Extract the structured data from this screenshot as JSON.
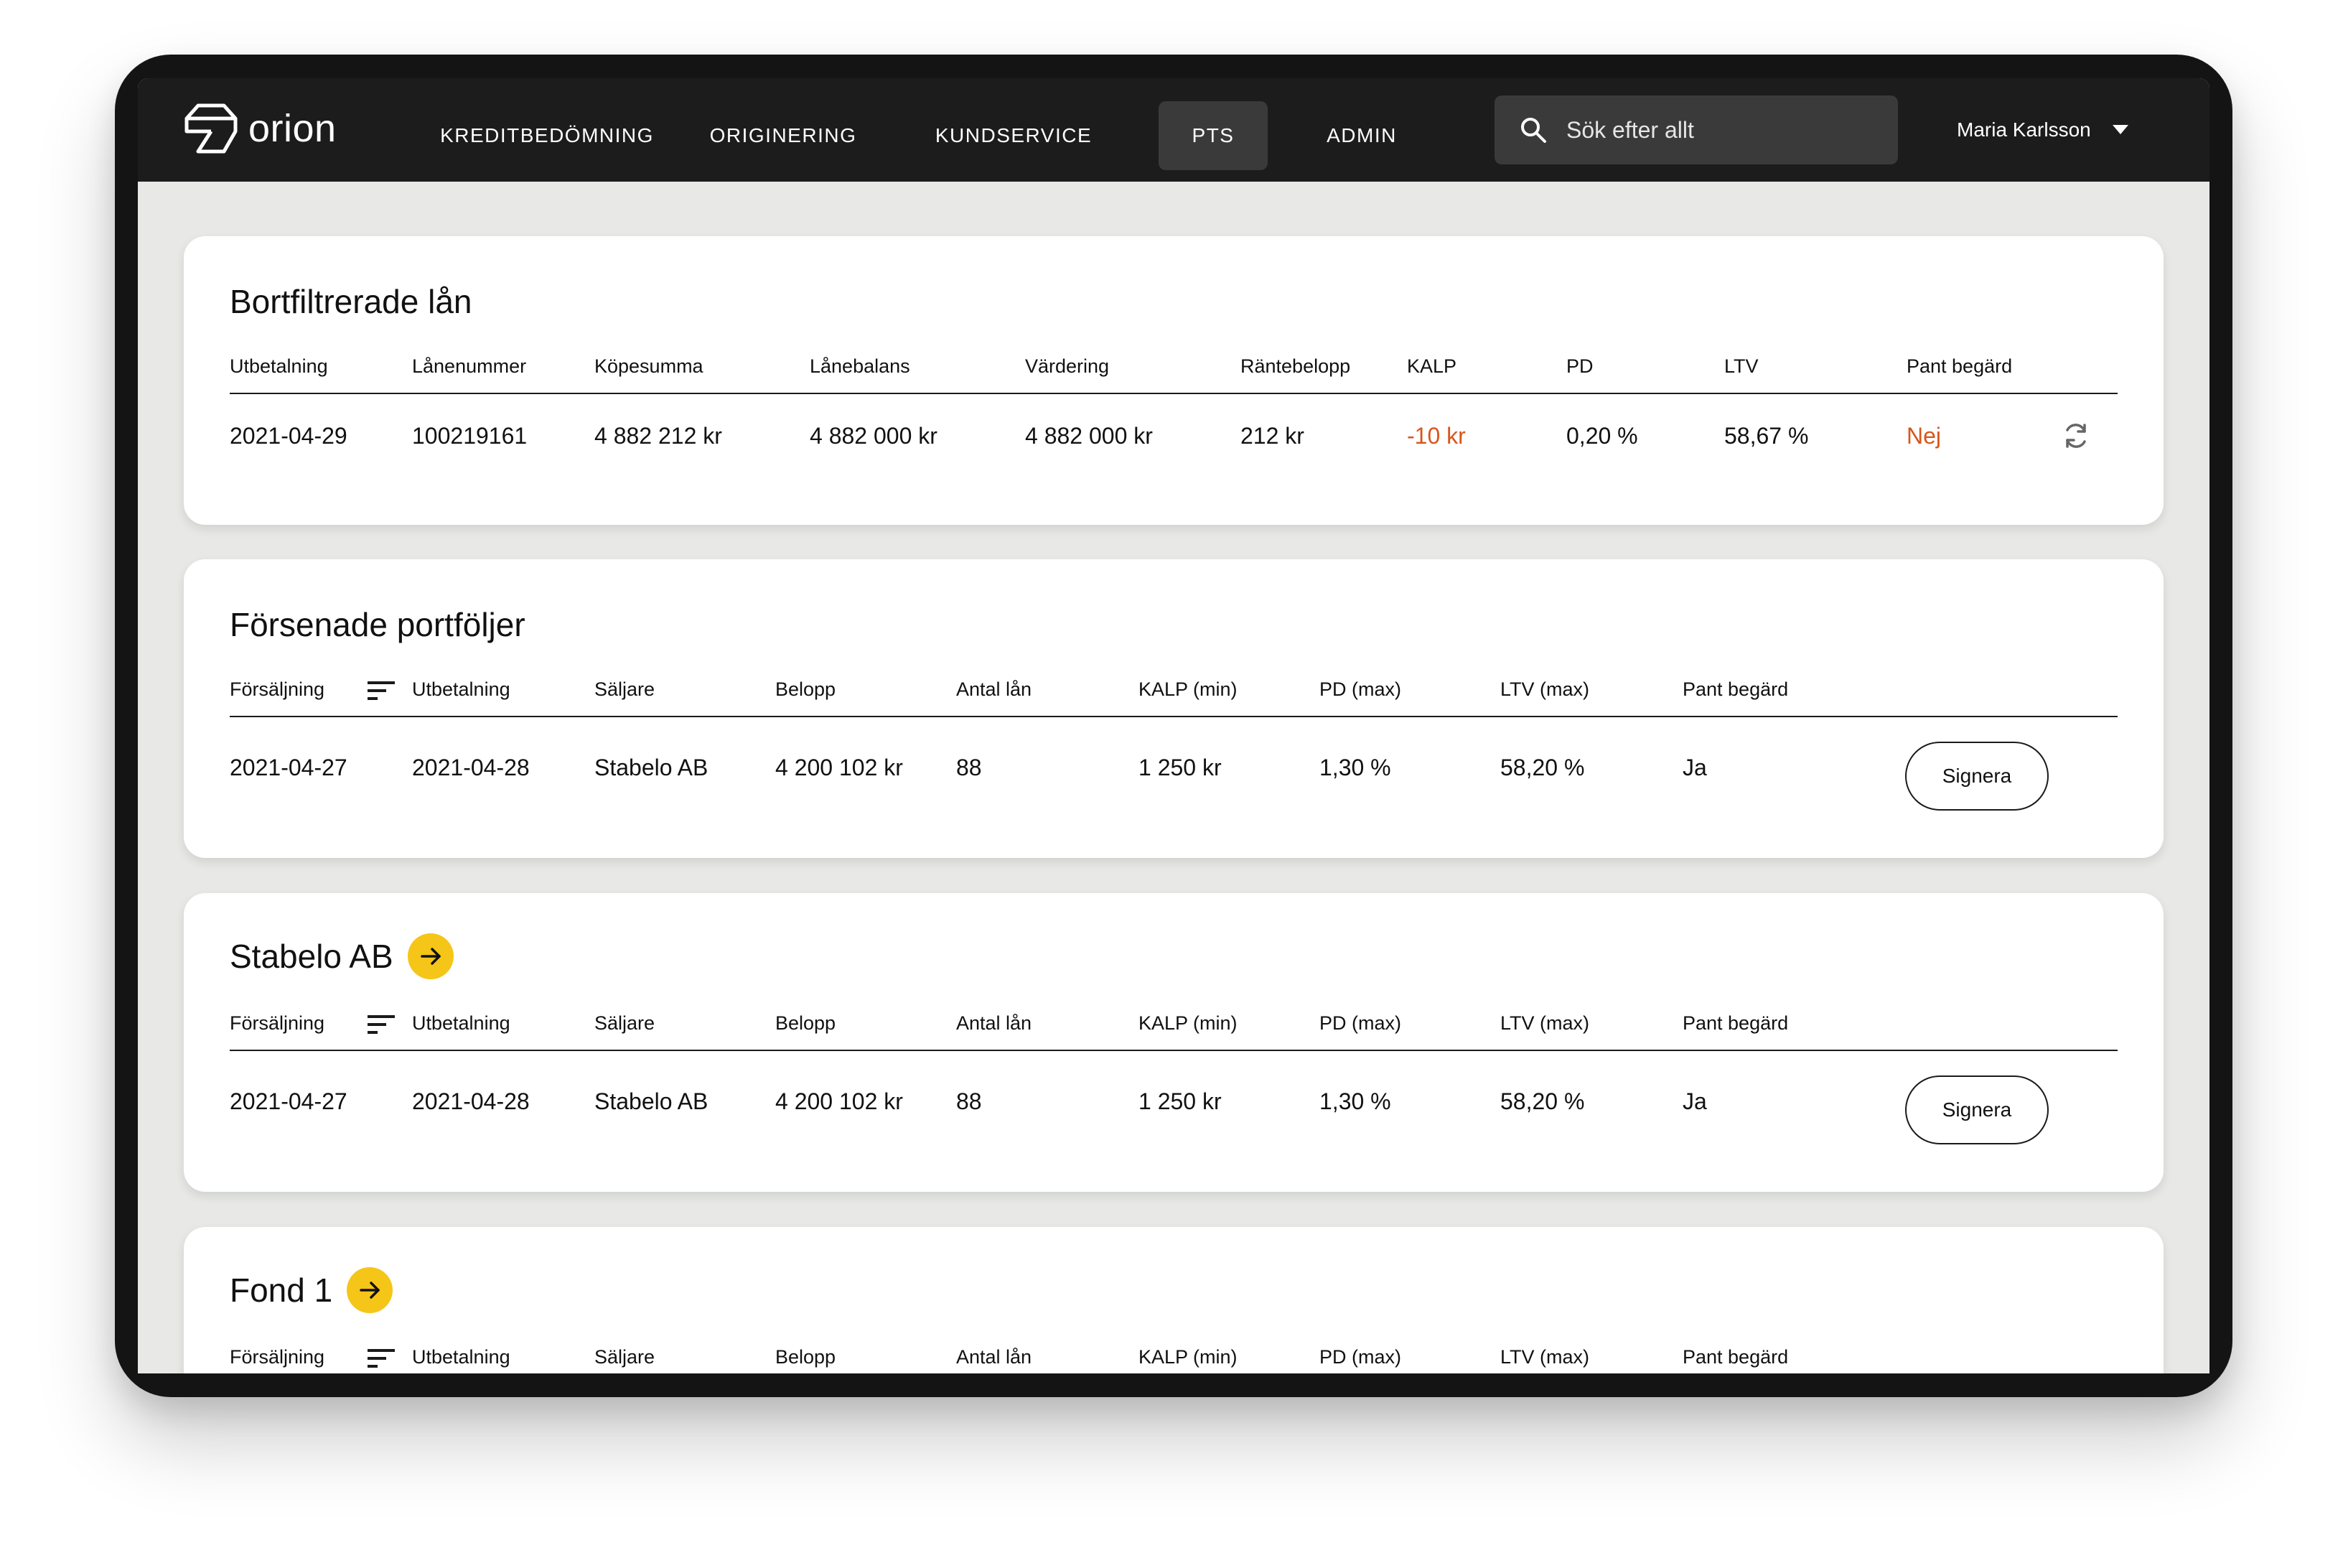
{
  "app": {
    "logo_text": "orion"
  },
  "nav": {
    "items": [
      {
        "label": "KREDITBEDÖMNING"
      },
      {
        "label": "ORIGINERING"
      },
      {
        "label": "KUNDSERVICE"
      },
      {
        "label": "PTS",
        "active": true
      },
      {
        "label": "ADMIN"
      }
    ],
    "search_placeholder": "Sök efter allt",
    "user_name": "Maria Karlsson"
  },
  "filtered_loans": {
    "title": "Bortfiltrerade lån",
    "headers": [
      "Utbetalning",
      "Lånenummer",
      "Köpesumma",
      "Lånebalans",
      "Värdering",
      "Räntebelopp",
      "KALP",
      "PD",
      "LTV",
      "Pant begärd"
    ],
    "row": [
      "2021-04-29",
      "100219161",
      "4 882 212 kr",
      "4 882 000 kr",
      "4 882 000 kr",
      "212 kr",
      "-10 kr",
      "0,20 %",
      "58,67 %",
      "Nej"
    ]
  },
  "delayed_portfolios": {
    "title": "Försenade portföljer",
    "headers": [
      "Försäljning",
      "Utbetalning",
      "Säljare",
      "Belopp",
      "Antal lån",
      "KALP (min)",
      "PD (max)",
      "LTV (max)",
      "Pant begärd"
    ],
    "row": [
      "2021-04-27",
      "2021-04-28",
      "Stabelo AB",
      "4 200 102 kr",
      "88",
      "1 250 kr",
      "1,30 %",
      "58,20 %",
      "Ja"
    ],
    "action_label": "Signera"
  },
  "stabelo": {
    "title": "Stabelo AB",
    "headers": [
      "Försäljning",
      "Utbetalning",
      "Säljare",
      "Belopp",
      "Antal lån",
      "KALP (min)",
      "PD (max)",
      "LTV (max)",
      "Pant begärd"
    ],
    "row": [
      "2021-04-27",
      "2021-04-28",
      "Stabelo AB",
      "4 200 102 kr",
      "88",
      "1 250 kr",
      "1,30 %",
      "58,20 %",
      "Ja"
    ],
    "action_label": "Signera"
  },
  "fond1": {
    "title": "Fond 1",
    "headers": [
      "Försäljning",
      "Utbetalning",
      "Säljare",
      "Belopp",
      "Antal lån",
      "KALP (min)",
      "PD (max)",
      "LTV (max)",
      "Pant begärd"
    ]
  },
  "colors": {
    "negative": "#d7561b",
    "accent_yellow": "#f5c518",
    "topbar": "#1c1c1c",
    "background": "#e8e9e6"
  },
  "icons": [
    "orion-logo-icon",
    "search-icon",
    "caret-down-icon",
    "refresh-icon",
    "sort-icon",
    "arrow-right-icon"
  ]
}
